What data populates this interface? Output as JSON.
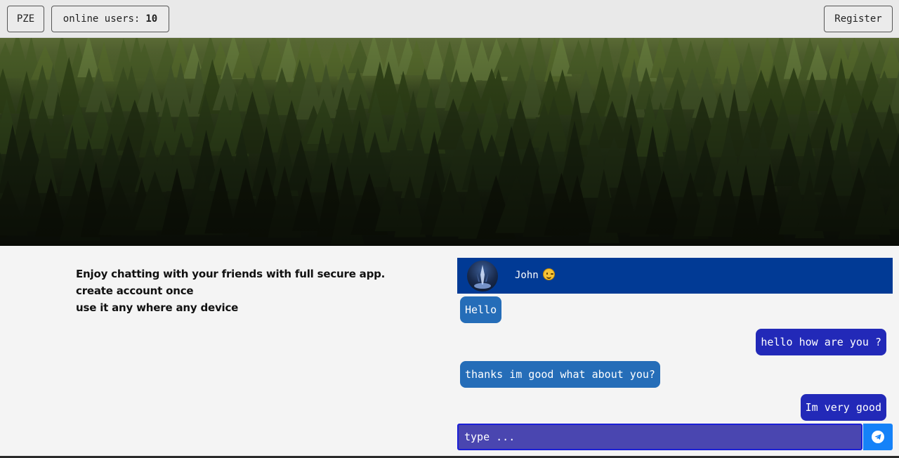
{
  "header": {
    "brand_label": "PZE",
    "online_label": "online users:",
    "online_count": "10",
    "register_label": "Register"
  },
  "hero": {
    "image_name": "forest-banner"
  },
  "intro": {
    "lines": [
      "Enjoy chatting with your friends with full secure app.",
      "create account once",
      "use it any where any device"
    ]
  },
  "chat": {
    "contact_name": "John",
    "contact_emoji": "winking-face-icon",
    "messages": [
      {
        "direction": "in",
        "text": "Hello"
      },
      {
        "direction": "out",
        "text": "hello how are you ?"
      },
      {
        "direction": "in",
        "text": "thanks im good what about you?"
      },
      {
        "direction": "out",
        "text": "Im very good"
      }
    ],
    "input": {
      "placeholder": "type ...",
      "value": ""
    },
    "send_icon": "telegram-send-icon"
  },
  "colors": {
    "chat_header": "#013a95",
    "incoming_bubble": "#256db8",
    "outgoing_bubble": "#2229b8",
    "input_bg": "#4a46b0",
    "send_button": "#1582f8"
  }
}
